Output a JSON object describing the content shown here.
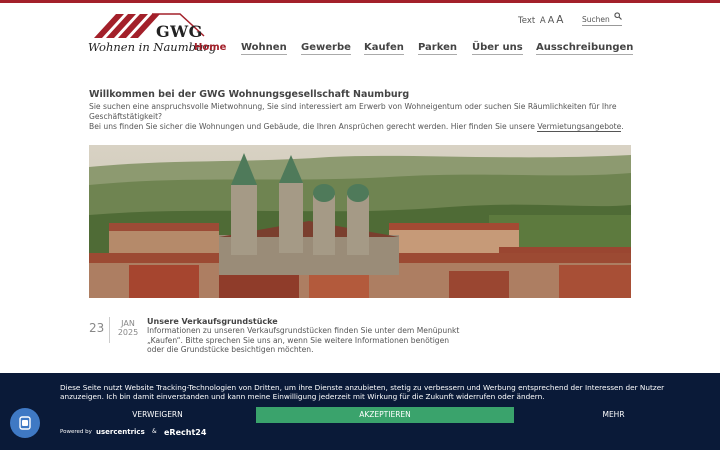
{
  "header": {
    "logo_text": "GWG",
    "logo_subtitle": "Wohnen in Naumburg",
    "text_size_label": "Text",
    "text_size_options": [
      "A",
      "A",
      "A"
    ],
    "search_placeholder": "Suchen",
    "accent_color": "#a3202a"
  },
  "nav": {
    "items": [
      {
        "label": "Home",
        "active": true
      },
      {
        "label": "Wohnen",
        "active": false
      },
      {
        "label": "Gewerbe",
        "active": false
      },
      {
        "label": "Kaufen",
        "active": false
      },
      {
        "label": "Parken",
        "active": false
      },
      {
        "label": "Über uns",
        "active": false
      },
      {
        "label": "Ausschreibungen",
        "active": false
      }
    ]
  },
  "main": {
    "title": "Willkommen bei der GWG Wohnungsgesellschaft Naumburg",
    "intro_line1": "Sie suchen eine anspruchsvolle Mietwohnung, Sie sind interessiert am Erwerb von Wohneigentum oder suchen Sie Räumlichkeiten für Ihre Geschäftstätigkeit?",
    "intro_line2": "Bei uns finden Sie sicher die Wohnungen und Gebäude, die Ihren Ansprüchen gerecht werden. Hier finden Sie unsere ",
    "intro_link": "Vermietungsangebote",
    "intro_end": "."
  },
  "news": {
    "day": "23",
    "month": "JAN",
    "year": "2025",
    "title": "Unsere Verkaufsgrundstücke",
    "body": "Informationen zu unseren Verkaufsgrundstücken finden Sie unter dem Menüpunkt „Kaufen“. Bitte sprechen Sie uns an, wenn Sie weitere Informationen benötigen oder die Grundstücke besichtigen möchten."
  },
  "cookie": {
    "text": "Diese Seite nutzt Website Tracking-Technologien von Dritten, um ihre Dienste anzubieten, stetig zu verbessern und Werbung entsprechend der Interessen der Nutzer anzuzeigen. Ich bin damit einverstanden und kann meine Einwilligung jederzeit mit Wirkung für die Zukunft widerrufen oder ändern.",
    "deny_label": "VERWEIGERN",
    "accept_label": "AKZEPTIEREN",
    "more_label": "MEHR",
    "powered_by": "Powered by",
    "usercentrics": "usercentrics",
    "amp": "&",
    "erecht": "eRecht24",
    "background": "#0a1a38",
    "accept_color": "#3aa36c"
  }
}
